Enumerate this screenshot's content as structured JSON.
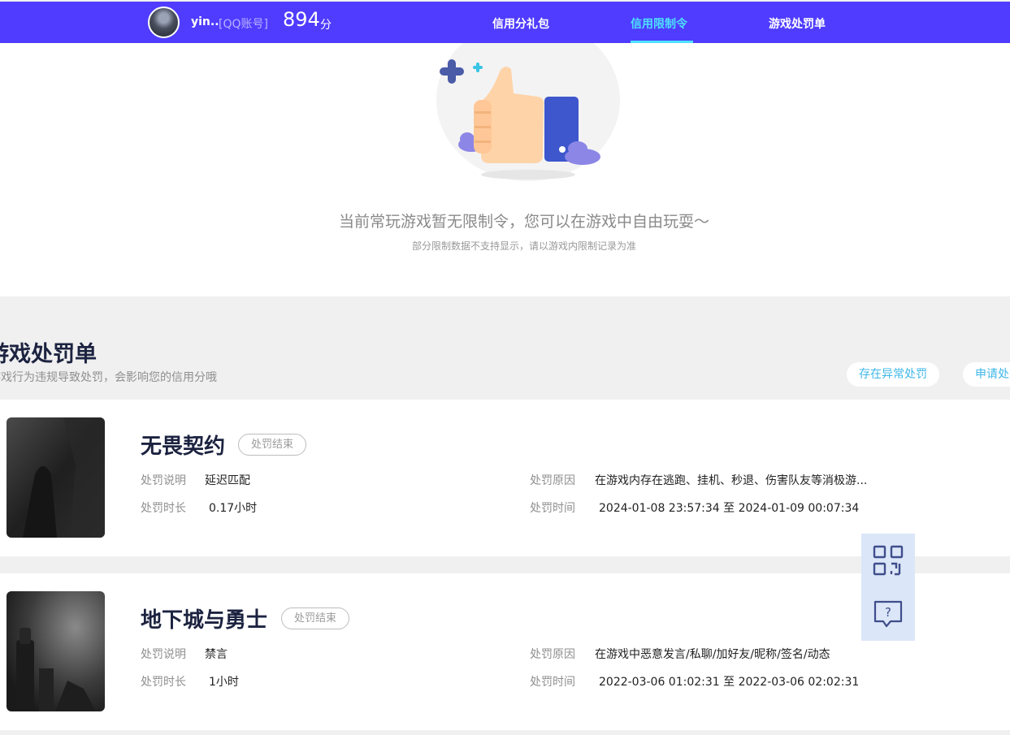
{
  "header": {
    "username": "yin..",
    "account_type": "[QQ账号]",
    "score": "894",
    "score_unit": "分",
    "nav": [
      {
        "label": "信用分礼包"
      },
      {
        "label": "信用限制令"
      },
      {
        "label": "游戏处罚单"
      }
    ],
    "active_index": 1
  },
  "restriction": {
    "empty_message": "当前常玩游戏暂无限制令，您可以在游戏中自由玩耍～",
    "sub_message": "部分限制数据不支持显示，请以游戏内限制记录为准"
  },
  "penalties": {
    "title": "游戏处罚单",
    "description": "游戏行为违规导致处罚，会影响您的信用分哦",
    "actions": [
      {
        "label": "存在异常处罚"
      },
      {
        "label": "申请处罚"
      }
    ],
    "labels": {
      "description": "处罚说明",
      "duration": "处罚时长",
      "reason": "处罚原因",
      "time": "处罚时间"
    },
    "items": [
      {
        "game": "无畏契约",
        "status": "处罚结束",
        "description": "延迟匹配",
        "duration": "0.17小时",
        "reason": "在游戏内存在逃跑、挂机、秒退、伤害队友等消极游...",
        "time": "2024-01-08 23:57:34 至 2024-01-09 00:07:34"
      },
      {
        "game": "地下城与勇士",
        "status": "处罚结束",
        "description": "禁言",
        "duration": "1小时",
        "reason": "在游戏中恶意发言/私聊/加好友/昵称/签名/动态",
        "time": "2022-03-06 01:02:31 至 2022-03-06 02:02:31"
      }
    ]
  },
  "colors": {
    "nav_bg": "#4f3cff",
    "nav_active": "#4ee1ff",
    "link": "#3fb7e8",
    "title": "#1c2340"
  },
  "icons": {
    "side_top": "qr-code-icon",
    "side_bottom": "help-chat-icon"
  }
}
